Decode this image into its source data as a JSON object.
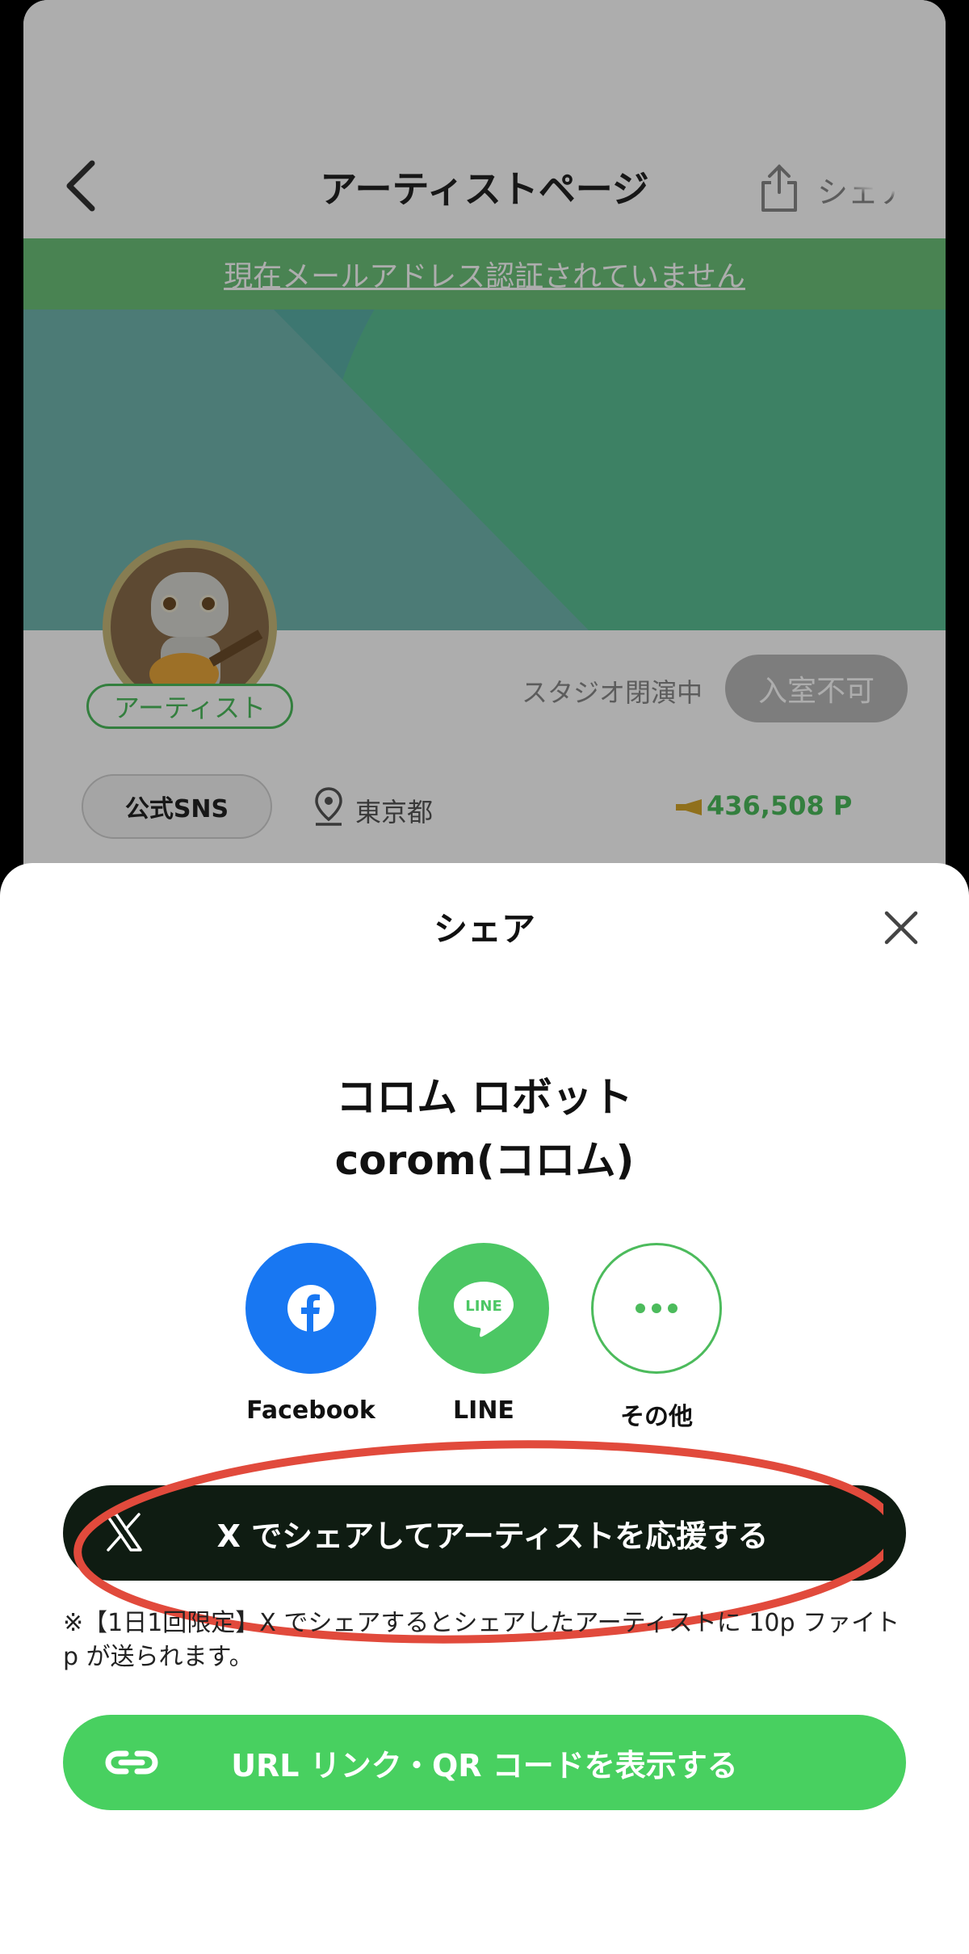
{
  "header": {
    "title": "アーティストページ",
    "share_label": "シェア"
  },
  "notice": {
    "text": "現在メールアドレス認証されていません"
  },
  "profile": {
    "tag": "アーティスト",
    "studio_status": "スタジオ閉演中",
    "enter_button": "入室不可",
    "sns_button": "公式SNS",
    "location": "東京都",
    "points": "436,508 P"
  },
  "share_sheet": {
    "title": "シェア",
    "artist_name": "コロム ロボット",
    "artist_sub": "corom(コロム)",
    "options": [
      {
        "label": "Facebook",
        "icon": "facebook-icon",
        "color": "#1877f2"
      },
      {
        "label": "LINE",
        "icon": "line-icon",
        "color": "#4cc764"
      },
      {
        "label": "その他",
        "icon": "more-icon",
        "color": "#4cbb5c"
      }
    ],
    "x_button": "X でシェアしてアーティストを応援する",
    "note": "※【1日1回限定】X でシェアするとシェアしたアーティストに 10p ファイト p が送られます。",
    "url_button": "URL リンク・QR コードを表示する"
  },
  "colors": {
    "brand_green": "#48d060",
    "x_button_bg": "#0f1c12",
    "annotation_red": "#e14a3c"
  }
}
